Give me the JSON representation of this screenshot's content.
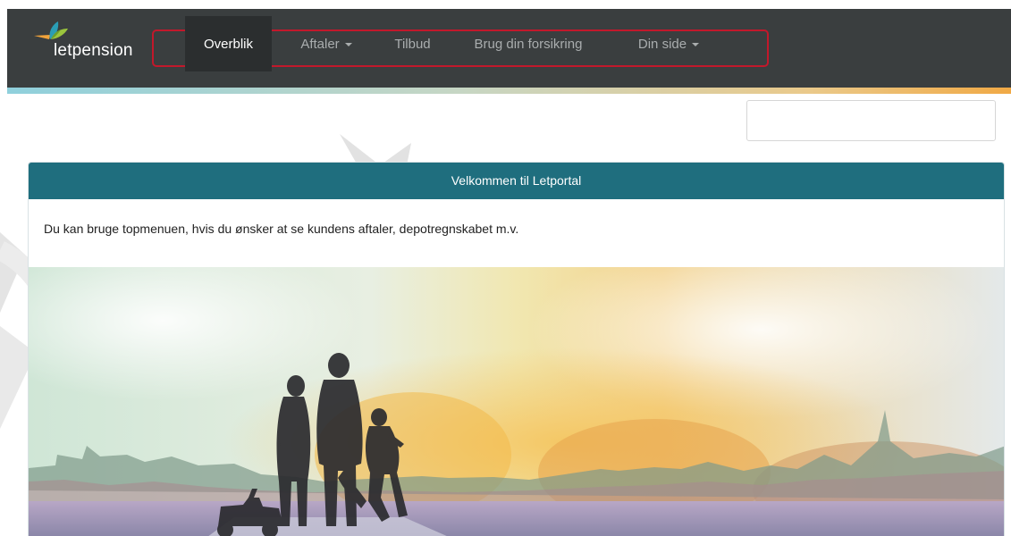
{
  "brand": {
    "name": "letpension",
    "colors": {
      "navbar": "#3a3e3f",
      "nav_active": "#2b2e2f",
      "panel_header": "#1f6e7e",
      "highlight_frame": "#c2182b",
      "logo_orange": "#f0a23a",
      "logo_green": "#9bc53d",
      "logo_blue": "#2a9db5"
    }
  },
  "nav": {
    "items": [
      {
        "label": "Overblik",
        "active": true
      },
      {
        "label": "Aftaler",
        "dropdown": true
      },
      {
        "label": "Tilbud"
      },
      {
        "label": "Brug din forsikring"
      },
      {
        "label": "Din side",
        "dropdown": true
      }
    ]
  },
  "search": {
    "value": "",
    "placeholder": ""
  },
  "panel": {
    "title": "Velkommen til Letportal",
    "text": "Du kan bruge topmenuen, hvis du ønsker at se kundens aftaler, depotregnskabet m.v."
  },
  "icons": {
    "logo": "letpension-leaf-icon",
    "caret": "caret-down-icon"
  }
}
